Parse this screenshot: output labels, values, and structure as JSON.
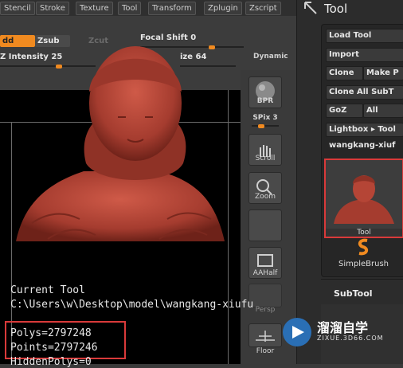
{
  "menubar": {
    "items": [
      "Stencil",
      "Stroke",
      "Texture",
      "Tool",
      "Transform",
      "Zplugin",
      "Zscript"
    ]
  },
  "toolbar": {
    "zadd_label": "dd",
    "zsub_label": "Zsub",
    "zcut_label": "Zcut",
    "focal_shift": "Focal Shift 0",
    "z_intensity": "Z Intensity 25",
    "draw_size": "ize 64",
    "dynamic": "Dynamic"
  },
  "side": {
    "bpr_label": "BPR",
    "spix": "SPix 3",
    "scroll": "Scroll",
    "zoom": "Zoom",
    "aahalf": "AAHalf",
    "persp": "Persp",
    "floor": "Floor"
  },
  "tool_panel": {
    "title": "Tool",
    "load_tool": "Load Tool",
    "import": "Import",
    "clone": "Clone",
    "make_poly": "Make P",
    "clone_all": "Clone All SubT",
    "goz": "GoZ",
    "all": "All",
    "lightbox": "Lightbox ▸ Tool",
    "model_name": "wangkang-xiuf",
    "thumb_label": "Tool",
    "simplebrush": "SimpleBrush",
    "subtool": "SubTool"
  },
  "overlay": {
    "current_tool": "Current Tool",
    "path": "C:\\Users\\w\\Desktop\\model\\wangkang-xiufu",
    "polys": "Polys=2797248",
    "points": "Points=2797246",
    "hidden": "HiddenPolys=0"
  },
  "watermark": {
    "title": "溜溜自学",
    "url": "ZIXUE.3D66.COM"
  },
  "colors": {
    "accent": "#f08a20",
    "highlight": "#d93a3a",
    "model": "#b54536"
  }
}
